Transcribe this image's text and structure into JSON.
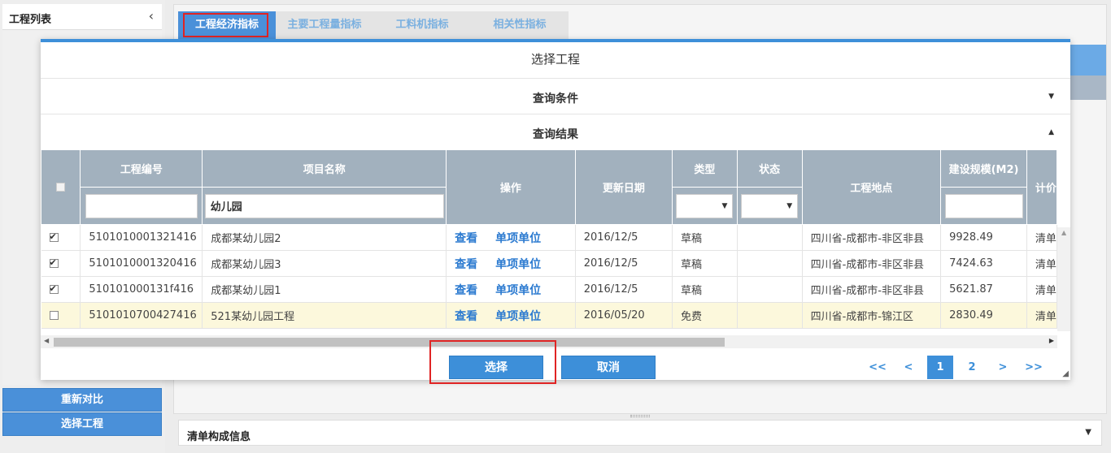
{
  "sidebar": {
    "title": "工程列表",
    "buttons": [
      "重新对比",
      "选择工程"
    ]
  },
  "tabs": [
    "工程经济指标",
    "主要工程量指标",
    "工料机指标",
    "相关性指标"
  ],
  "bottom": {
    "label": "清单构成信息"
  },
  "dialog": {
    "title": "选择工程",
    "query_section": "查询条件",
    "result_section": "查询结果",
    "columns": [
      "工程编号",
      "项目名称",
      "操作",
      "更新日期",
      "类型",
      "状态",
      "工程地点",
      "建设规模(M2)",
      "计价"
    ],
    "filters": {
      "project_name": "幼儿园",
      "project_no": "",
      "scale": ""
    },
    "rows": [
      {
        "checked": true,
        "no": "5101010001321416",
        "name": "成都某幼儿园2",
        "view": "查看",
        "unit": "单项单位",
        "date": "2016/12/5",
        "type": "草稿",
        "status": "",
        "place": "四川省-成都市-非区非县",
        "scale": "9928.49",
        "pricing": "清单"
      },
      {
        "checked": true,
        "no": "5101010001320416",
        "name": "成都某幼儿园3",
        "view": "查看",
        "unit": "单项单位",
        "date": "2016/12/5",
        "type": "草稿",
        "status": "",
        "place": "四川省-成都市-非区非县",
        "scale": "7424.63",
        "pricing": "清单"
      },
      {
        "checked": true,
        "no": "510101000131f416",
        "name": "成都某幼儿园1",
        "view": "查看",
        "unit": "单项单位",
        "date": "2016/12/5",
        "type": "草稿",
        "status": "",
        "place": "四川省-成都市-非区非县",
        "scale": "5621.87",
        "pricing": "清单"
      },
      {
        "checked": false,
        "no": "5101010700427416",
        "name": "521某幼儿园工程",
        "view": "查看",
        "unit": "单项单位",
        "date": "2016/05/20",
        "type": "免费",
        "status": "",
        "place": "四川省-成都市-锦江区",
        "scale": "2830.49",
        "pricing": "清单"
      }
    ],
    "select_label": "选择",
    "cancel_label": "取消",
    "pager": {
      "first": "<<",
      "prev": "<",
      "pages": [
        "1",
        "2"
      ],
      "current": "1",
      "next": ">",
      "last": ">>"
    }
  },
  "colors": {
    "accent": "#3d8fd9",
    "header_gray": "#a2b1be",
    "highlight_row": "#fcf8dc",
    "annotation_red": "#e02424"
  }
}
